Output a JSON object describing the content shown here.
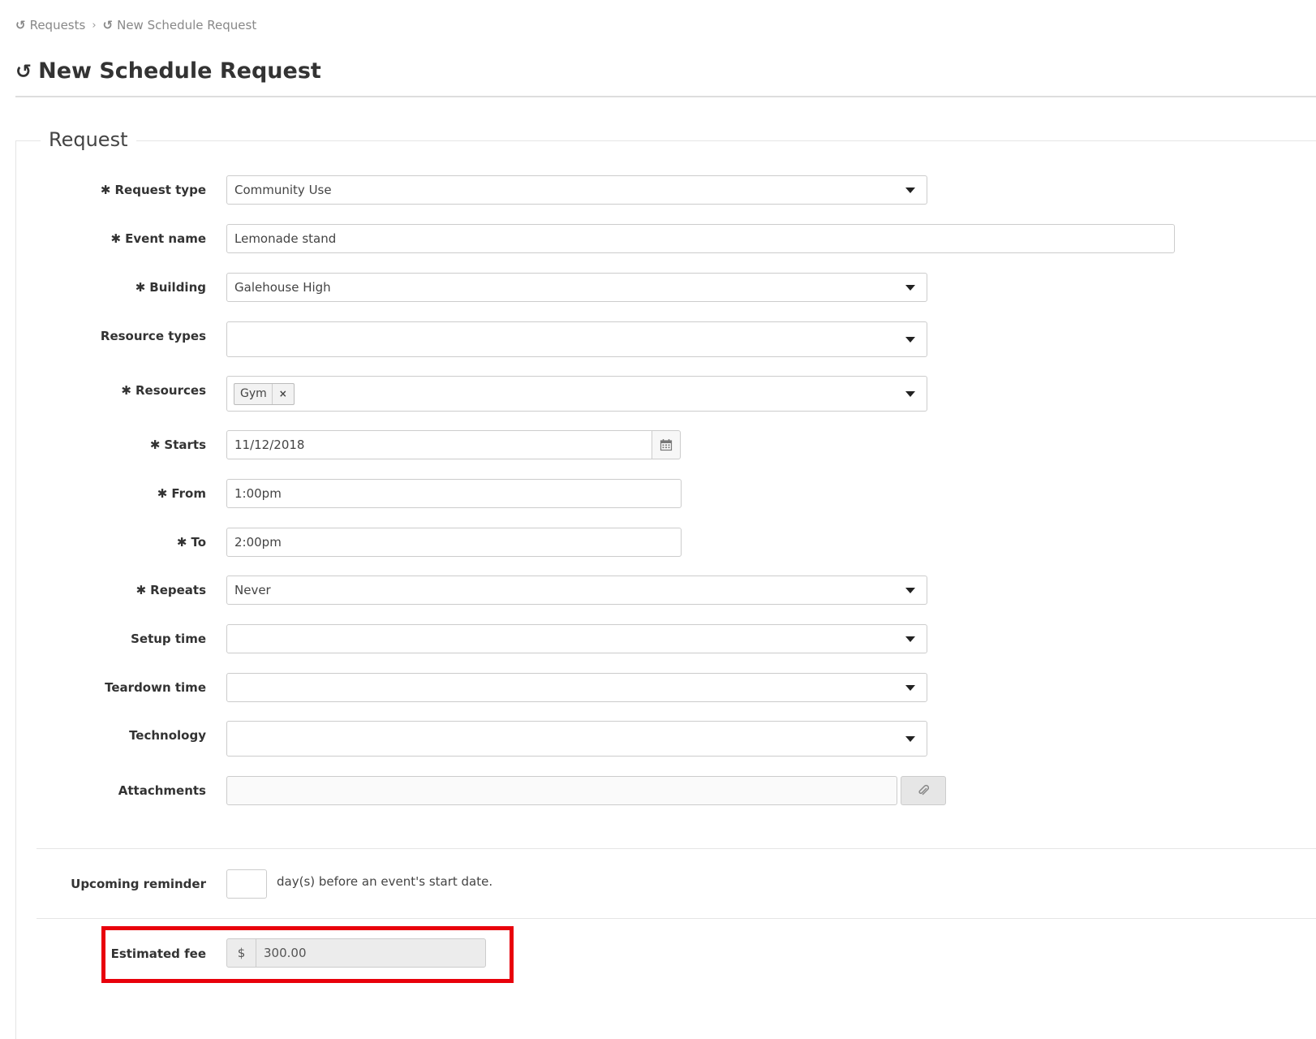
{
  "breadcrumb": {
    "items": [
      "Requests",
      "New Schedule Request"
    ],
    "separator": "›"
  },
  "page": {
    "title": "New Schedule Request",
    "history_icon": "history-icon"
  },
  "fieldset": {
    "legend": "Request"
  },
  "required_marker": "✱",
  "fields": {
    "request_type": {
      "label": "Request type",
      "value": "Community Use",
      "required": true
    },
    "event_name": {
      "label": "Event name",
      "value": "Lemonade stand",
      "required": true
    },
    "building": {
      "label": "Building",
      "value": "Galehouse High",
      "required": true
    },
    "resource_types": {
      "label": "Resource types",
      "value": "",
      "required": false
    },
    "resources": {
      "label": "Resources",
      "tags": [
        "Gym"
      ],
      "tag_remove": "×",
      "required": true
    },
    "starts": {
      "label": "Starts",
      "value": "11/12/2018",
      "required": true
    },
    "from": {
      "label": "From",
      "value": "1:00pm",
      "required": true
    },
    "to": {
      "label": "To",
      "value": "2:00pm",
      "required": true
    },
    "repeats": {
      "label": "Repeats",
      "value": "Never",
      "required": true
    },
    "setup_time": {
      "label": "Setup time",
      "value": "",
      "required": false
    },
    "teardown_time": {
      "label": "Teardown time",
      "value": "",
      "required": false
    },
    "technology": {
      "label": "Technology",
      "value": "",
      "required": false
    },
    "attachments": {
      "label": "Attachments",
      "value": "",
      "required": false
    }
  },
  "reminder": {
    "label": "Upcoming reminder",
    "value": "",
    "hint": "day(s) before an event's start date."
  },
  "fee": {
    "label": "Estimated fee",
    "currency": "$",
    "value": "300.00"
  },
  "colors": {
    "highlight": "#e8000b",
    "border": "#cccccc",
    "readonly_bg": "#ececec"
  }
}
